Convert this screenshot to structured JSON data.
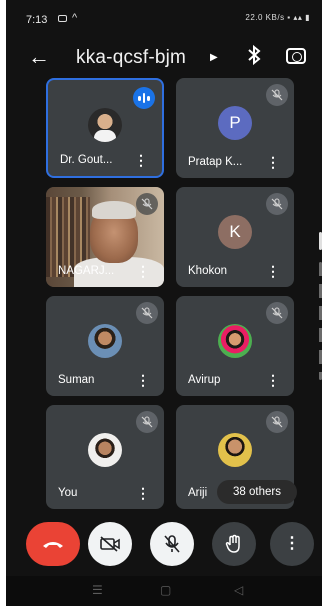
{
  "status_bar": {
    "time": "7:13",
    "system_icons": "22.0 KB/s · 4G · signal"
  },
  "header": {
    "meeting_code": "kka-qcsf-bjm"
  },
  "participants": [
    {
      "name": "Dr. Gout...",
      "avatar": "photo",
      "state": "speaking"
    },
    {
      "name": "Pratap K...",
      "avatar": "letter",
      "letter": "P",
      "color": "#5c6bc0",
      "state": "muted"
    },
    {
      "name": "NAGARJ...",
      "avatar": "video",
      "state": "muted"
    },
    {
      "name": "Khokon",
      "avatar": "letter",
      "letter": "K",
      "color": "#8d6e63",
      "state": "muted"
    },
    {
      "name": "Suman",
      "avatar": "photo",
      "state": "muted"
    },
    {
      "name": "Avirup",
      "avatar": "photo",
      "state": "muted"
    },
    {
      "name": "You",
      "avatar": "photo",
      "state": "muted"
    },
    {
      "name": "Ariji",
      "avatar": "photo",
      "state": "muted"
    }
  ],
  "others_count_label": "38 others",
  "colors": {
    "background": "#121212",
    "tile": "#3c4043",
    "accent": "#1a73e8",
    "end_call": "#ea4335"
  },
  "icons": {
    "back": "arrow-left-icon",
    "bluetooth": "bluetooth-icon",
    "switch_camera": "switch-camera-icon",
    "end_call": "phone-hangup-icon",
    "camera_off": "video-off-icon",
    "mic_off": "mic-off-icon",
    "raise_hand": "hand-icon",
    "more": "more-vert-icon"
  }
}
